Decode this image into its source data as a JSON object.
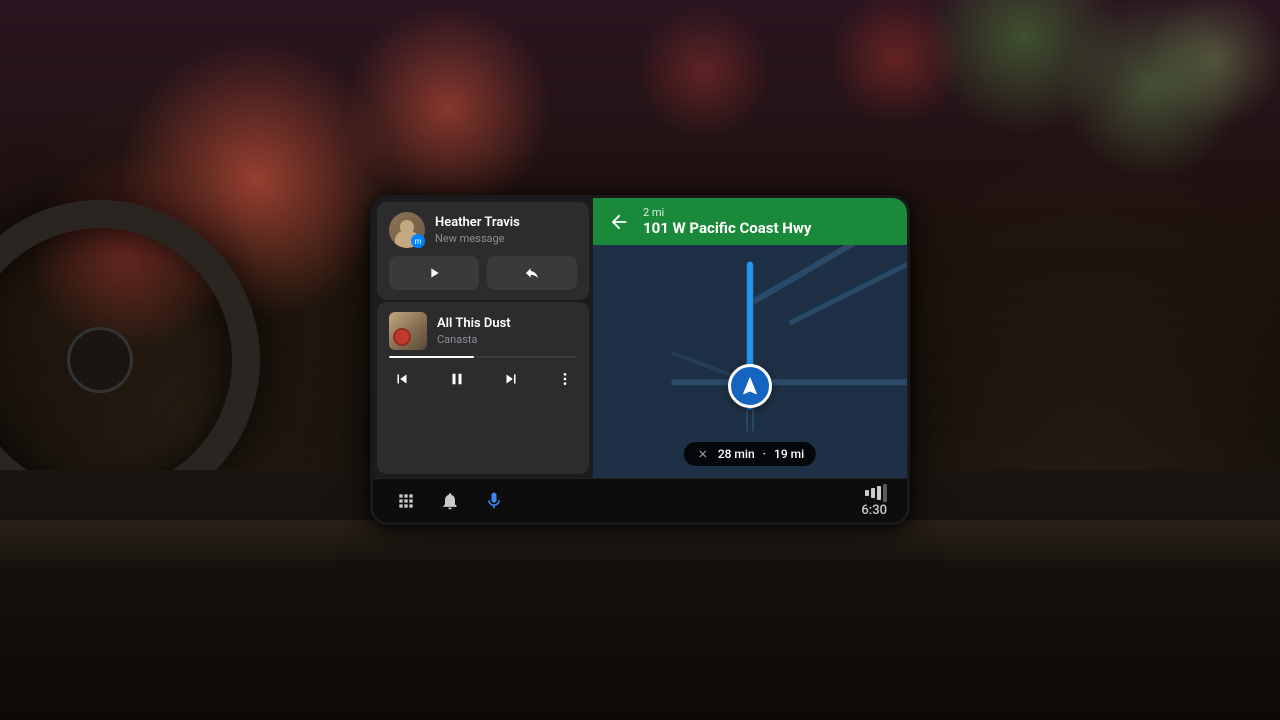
{
  "background": {
    "colors": {
      "bokeh_red": "#c84040",
      "bokeh_green": "#80a050",
      "dashboard": "#1a1510"
    }
  },
  "message_card": {
    "contact_name": "Heather Travis",
    "message_preview": "New message",
    "play_label": "Play",
    "reply_label": "Reply"
  },
  "music_card": {
    "song_title": "All This Dust",
    "artist_name": "Canasta",
    "progress_percent": 45
  },
  "navigation": {
    "turn_direction": "left",
    "distance": "2 mi",
    "street_name": "101 W Pacific Coast Hwy",
    "eta_time": "28 min",
    "eta_distance": "19 mi",
    "eta_separator": "·"
  },
  "bottom_bar": {
    "apps_icon": "grid-icon",
    "notification_icon": "bell-icon",
    "voice_icon": "mic-icon",
    "signal_icon": "signal-icon",
    "time": "6:30"
  }
}
